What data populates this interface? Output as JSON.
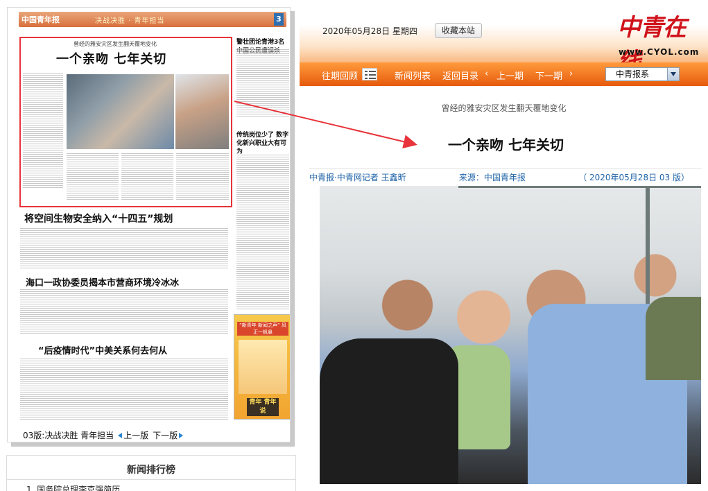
{
  "paper": {
    "masthead": "决战决胜 · 青年担当",
    "masthead_logo": "中国青年报",
    "masthead_page_no": "3",
    "lead_subtitle": "曾经的雅安灾区发生翻天覆地变化",
    "lead_title": "一个亲吻 七年关切",
    "headline_2": "将空间生物安全纳入“十四五”规划",
    "headline_3": "海口一政协委员揭本市营商环境冷冰冰",
    "headline_4": "“后疫情时代”中美关系何去何从",
    "right_title_1": "警壮团论青港3名中国公民遭误杀",
    "right_title_2": "传统岗位少了 数字化新兴职业大有可为",
    "ad_head": "“新青年 新闻之声” 风正一帆悬",
    "ad_foot": "青年 青年说"
  },
  "page_nav": {
    "current": "03版:决战决胜 青年担当",
    "prev": "上一版",
    "next": "下一版"
  },
  "ranking": {
    "title": "新闻排行榜",
    "items": [
      "1. 国务院总理李克强简历"
    ]
  },
  "header": {
    "date": "2020年05月28日  星期四",
    "bookmark": "收藏本站",
    "logo_cn": "中青在线",
    "logo_en": "www.CYOL.com"
  },
  "nav": {
    "history": "往期回顾",
    "news_list": "新闻列表",
    "back_to_index": "返回目录",
    "prev_issue": "上一期",
    "next_issue": "下一期",
    "prev_arrow": "‹",
    "next_arrow": "›",
    "select_value": "中青报系"
  },
  "article": {
    "subtitle": "曾经的雅安灾区发生翻天覆地变化",
    "title": "一个亲吻 七年关切",
    "author": "中青报·中青网记者 王鑫昕",
    "source": "来源：中国青年报",
    "meta": "（ 2020年05月28日    03 版）"
  },
  "colors": {
    "nav_orange": "#e65a0d",
    "highlight_red": "#e8333a",
    "byline_blue": "#1f63a8",
    "logo_red": "#d0131b"
  }
}
